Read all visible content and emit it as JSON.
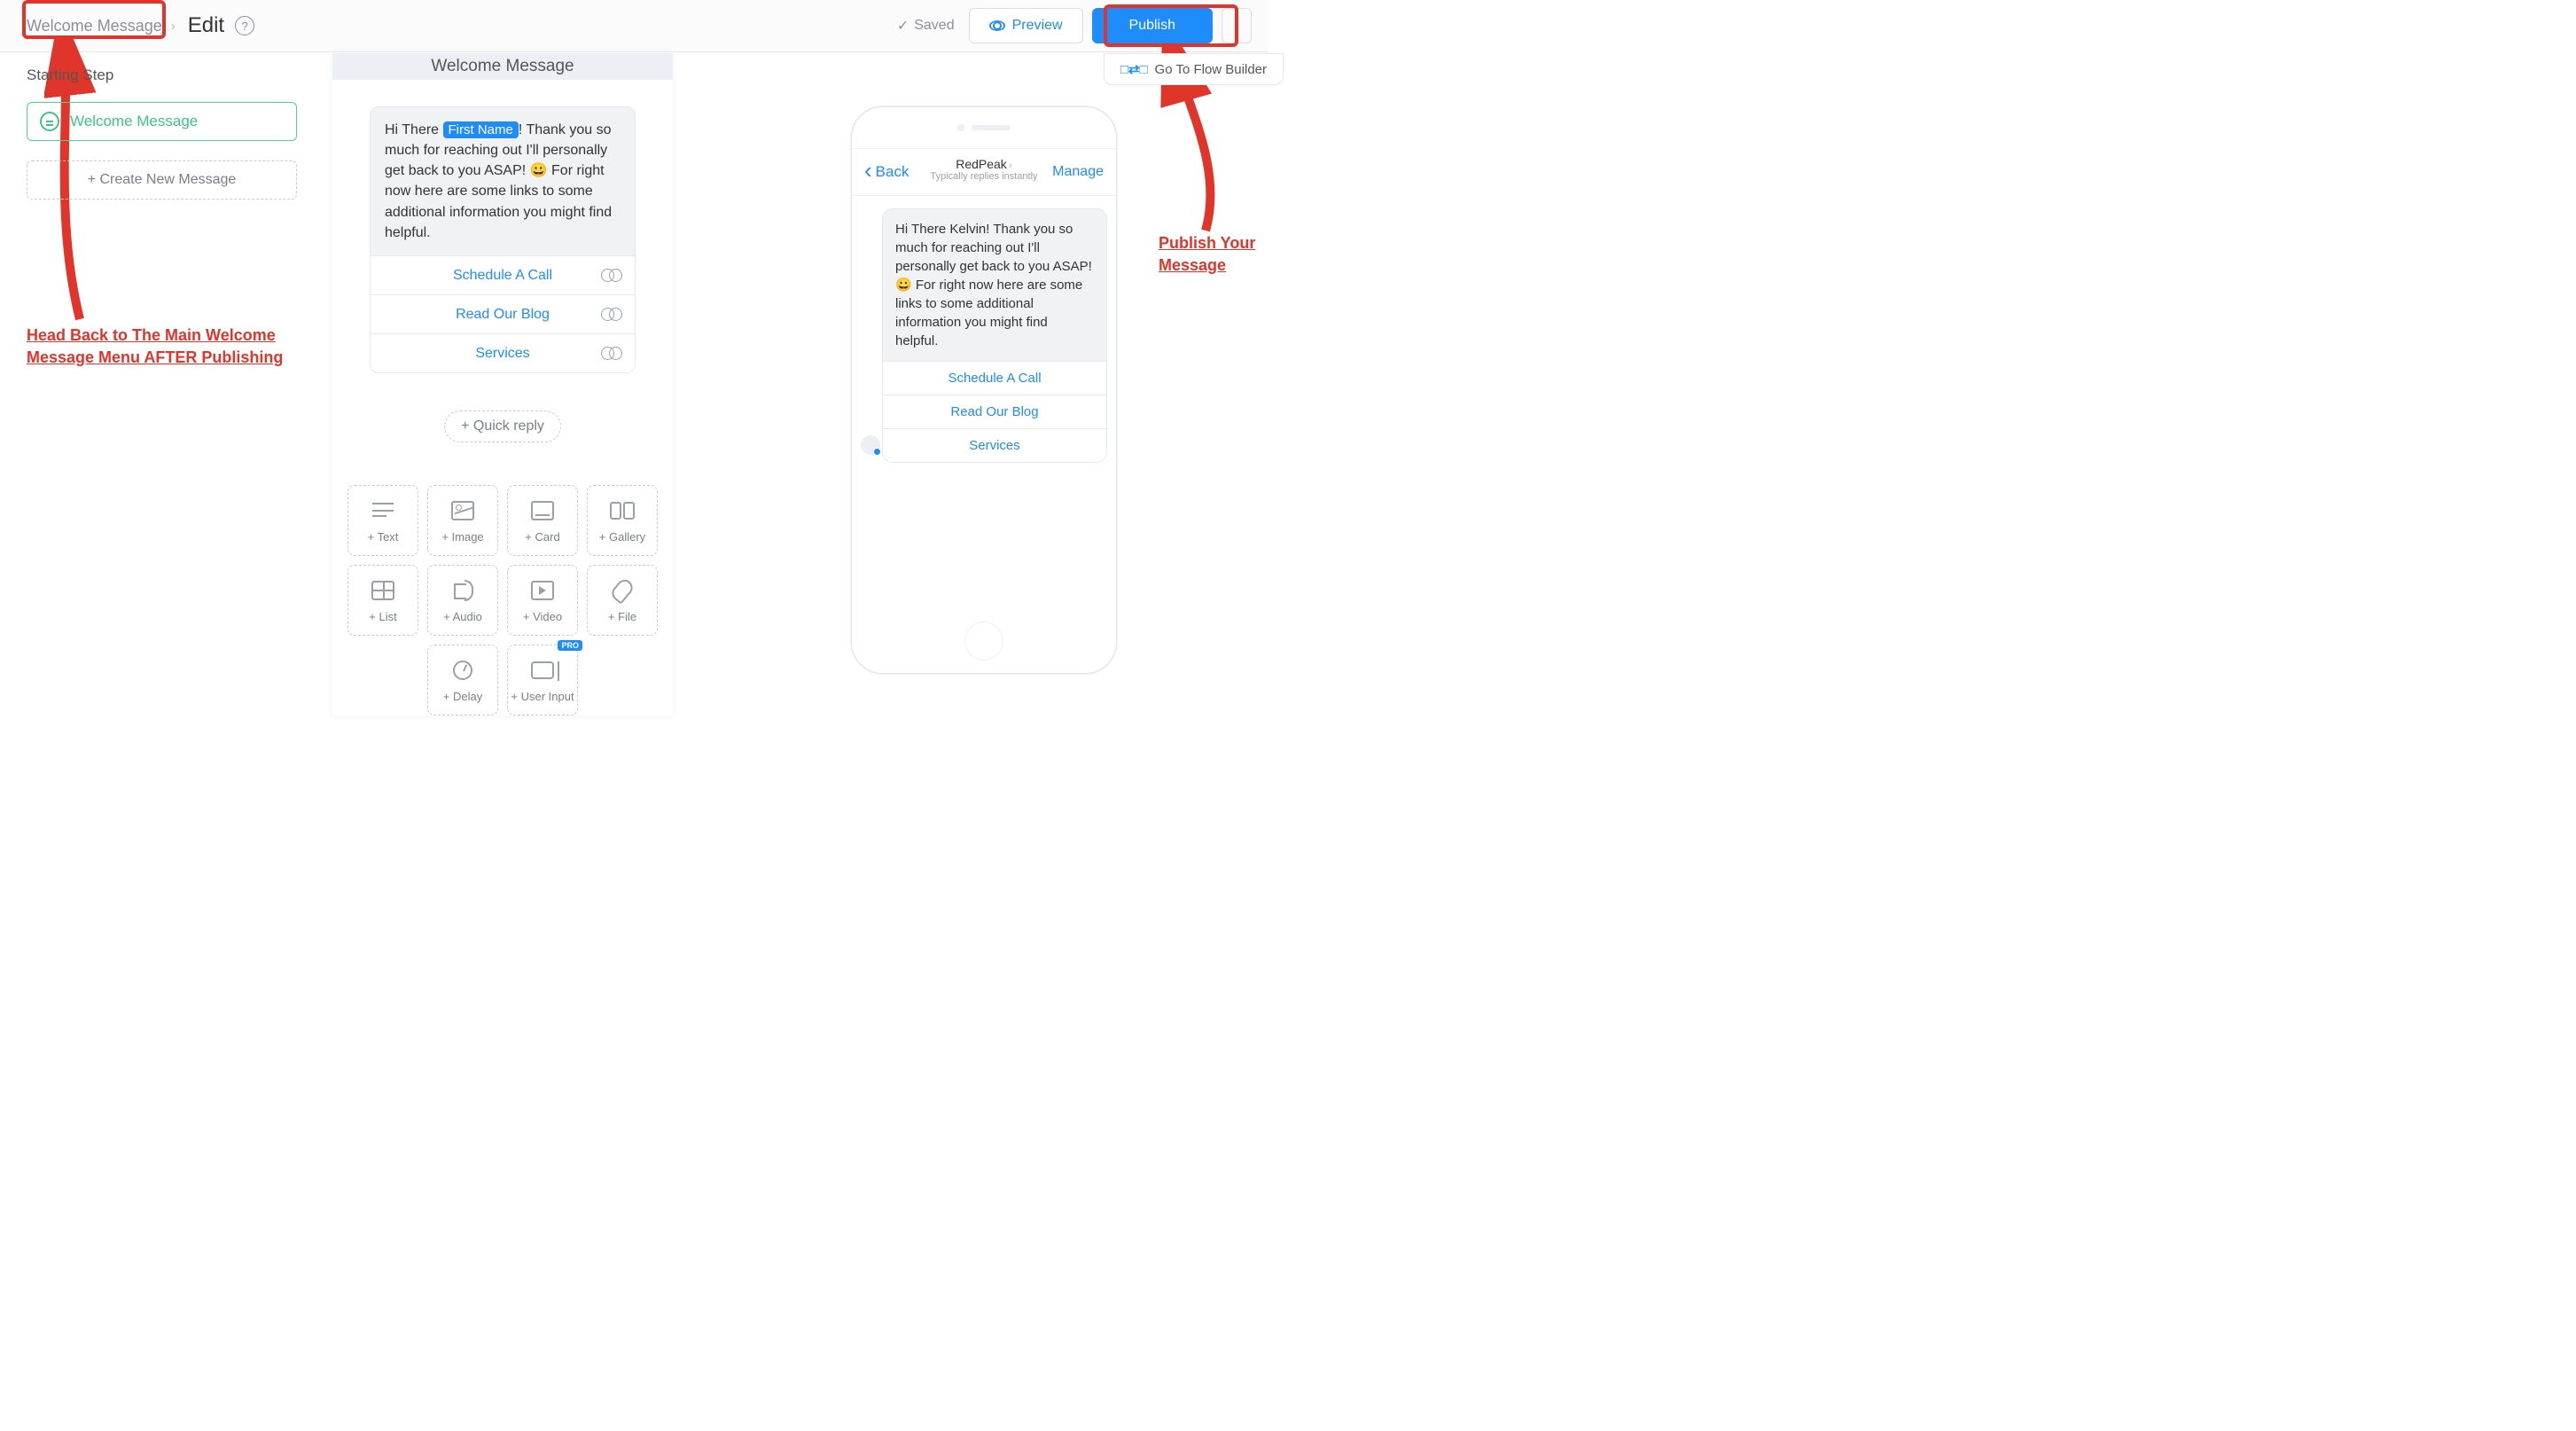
{
  "header": {
    "breadcrumb_link": "Welcome Message",
    "edit_label": "Edit",
    "saved_label": "Saved",
    "preview_label": "Preview",
    "publish_label": "Publish",
    "flow_builder_label": "Go To Flow Builder"
  },
  "sidebar": {
    "section_label": "Starting Step",
    "step_name": "Welcome Message",
    "create_label": "+ Create New Message"
  },
  "annotations": {
    "left": "Head Back to The Main Welcome Message Menu AFTER Publishing",
    "right": "Publish Your Message"
  },
  "editor": {
    "title": "Welcome Message",
    "msg_pre": "Hi There ",
    "msg_token": "First Name",
    "msg_post": "! Thank you so much for reaching out I'll personally get back to you ASAP! 😀 For right now here are some links to some additional information you might find helpful.",
    "buttons": [
      "Schedule A Call",
      "Read Our Blog",
      "Services"
    ],
    "quick_reply": "+ Quick reply",
    "tools": [
      {
        "label": "+ Text",
        "glyph": "text"
      },
      {
        "label": "+ Image",
        "glyph": "image"
      },
      {
        "label": "+ Card",
        "glyph": "card"
      },
      {
        "label": "+ Gallery",
        "glyph": "gallery"
      },
      {
        "label": "+ List",
        "glyph": "list"
      },
      {
        "label": "+ Audio",
        "glyph": "audio"
      },
      {
        "label": "+ Video",
        "glyph": "video"
      },
      {
        "label": "+ File",
        "glyph": "file"
      },
      {
        "label": "+ Delay",
        "glyph": "delay"
      },
      {
        "label": "+ User Input",
        "glyph": "input",
        "pro": true
      }
    ],
    "pro_badge": "PRO"
  },
  "phone": {
    "back": "Back",
    "title": "RedPeak",
    "subtitle": "Typically replies instantly",
    "manage": "Manage",
    "bubble": "Hi There Kelvin! Thank you so much for reaching out I'll personally get back to you ASAP! 😀 For right now here are some links to some additional information you might find helpful.",
    "buttons": [
      "Schedule A Call",
      "Read Our Blog",
      "Services"
    ]
  }
}
